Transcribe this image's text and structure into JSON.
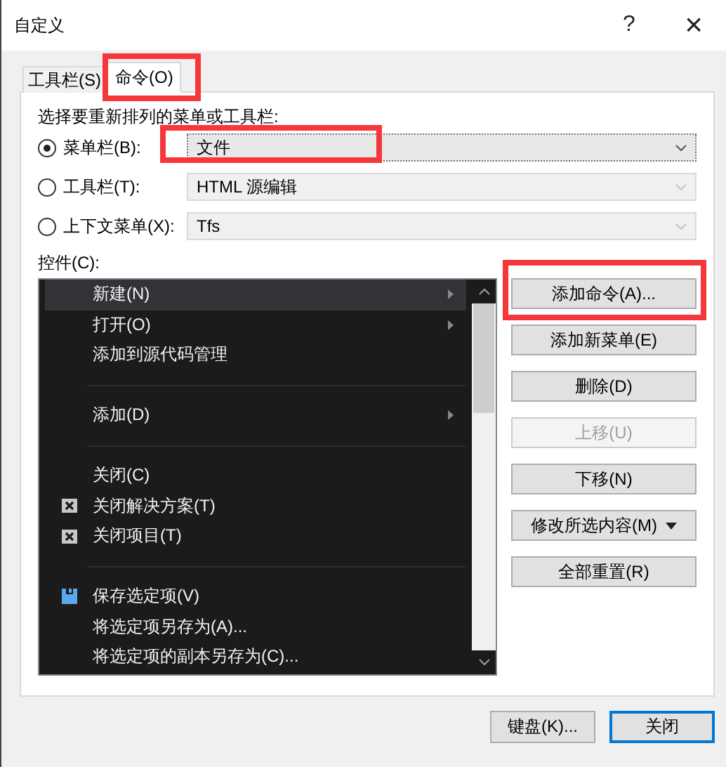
{
  "window": {
    "title": "自定义",
    "help": "?",
    "close": "×"
  },
  "tabs": [
    {
      "label": "工具栏(S)",
      "selected": false,
      "highlighted": false
    },
    {
      "label": "命令(O)",
      "selected": true,
      "highlighted": true
    }
  ],
  "prompt": "选择要重新排列的菜单或工具栏:",
  "targets": [
    {
      "label": "菜单栏(B):",
      "selected": true,
      "value": "文件",
      "disabled": false,
      "highlighted": true
    },
    {
      "label": "工具栏(T):",
      "selected": false,
      "value": "HTML 源编辑",
      "disabled": true,
      "highlighted": false
    },
    {
      "label": "上下文菜单(X):",
      "selected": false,
      "value": "Tfs",
      "disabled": true,
      "highlighted": false
    }
  ],
  "controls_label": "控件(C):",
  "controls": [
    {
      "kind": "submenu",
      "label": "新建(N)",
      "selected": true
    },
    {
      "kind": "submenu",
      "label": "打开(O)",
      "selected": false
    },
    {
      "kind": "command",
      "label": "添加到源代码管理",
      "selected": false
    },
    {
      "kind": "separator"
    },
    {
      "kind": "submenu",
      "label": "添加(D)",
      "selected": false
    },
    {
      "kind": "separator"
    },
    {
      "kind": "command",
      "label": "关闭(C)",
      "selected": false
    },
    {
      "kind": "closecommand",
      "label": "关闭解决方案(T)",
      "selected": false
    },
    {
      "kind": "closecommand",
      "label": "关闭项目(T)",
      "selected": false
    },
    {
      "kind": "separator"
    },
    {
      "kind": "savecommand",
      "label": "保存选定项(V)",
      "selected": false
    },
    {
      "kind": "command",
      "label": "将选定项另存为(A)...",
      "selected": false
    },
    {
      "kind": "command",
      "label": "将选定项的副本另存为(C)...",
      "selected": false
    }
  ],
  "actions": [
    {
      "label": "添加命令(A)...",
      "disabled": false,
      "highlighted": true,
      "dropdown": false
    },
    {
      "label": "添加新菜单(E)",
      "disabled": false,
      "highlighted": false,
      "dropdown": false
    },
    {
      "label": "删除(D)",
      "disabled": false,
      "highlighted": false,
      "dropdown": false
    },
    {
      "label": "上移(U)",
      "disabled": true,
      "highlighted": false,
      "dropdown": false
    },
    {
      "label": "下移(N)",
      "disabled": false,
      "highlighted": false,
      "dropdown": false
    },
    {
      "label": "修改所选内容(M)",
      "disabled": false,
      "highlighted": false,
      "dropdown": true
    },
    {
      "label": "全部重置(R)",
      "disabled": false,
      "highlighted": false,
      "dropdown": false
    }
  ],
  "buttons": [
    {
      "label": "键盘(K)...",
      "default": false
    },
    {
      "label": "关闭",
      "default": true
    }
  ]
}
